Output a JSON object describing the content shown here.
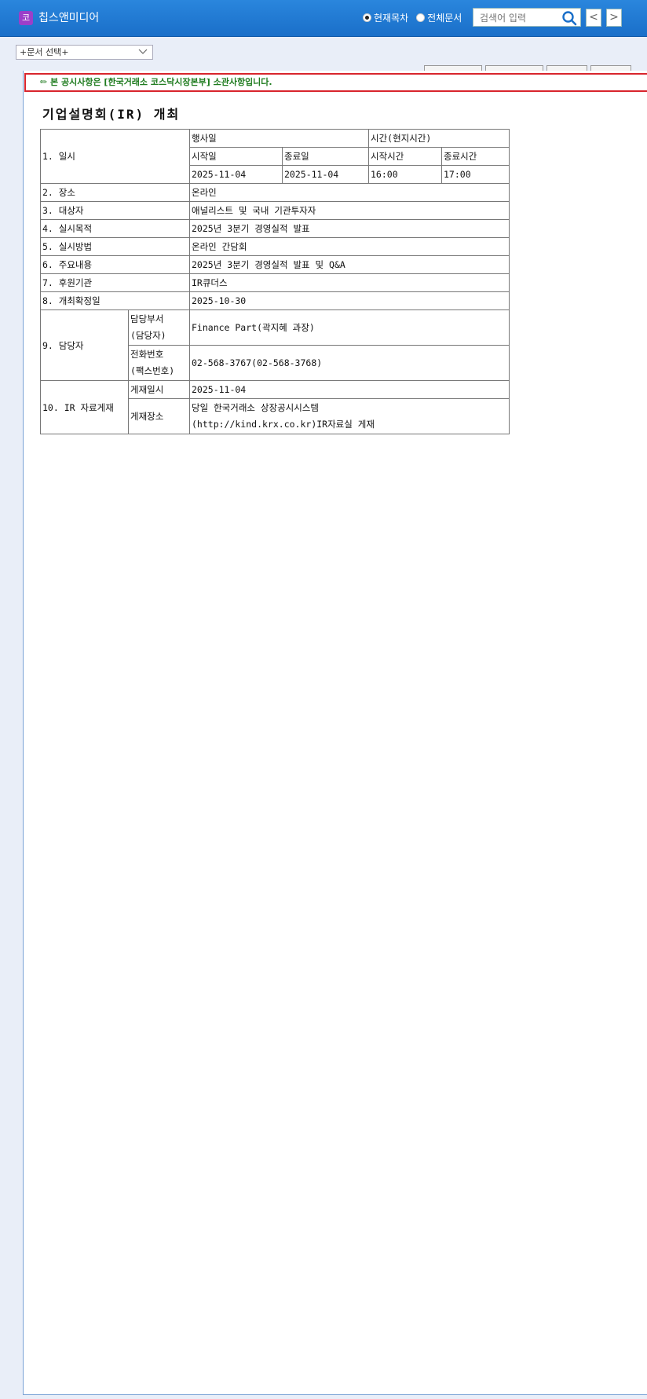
{
  "header": {
    "app_icon_text": "코",
    "app_title": "칩스앤미디어",
    "radio_current": "현재목차",
    "radio_all": "전체문서",
    "search_placeholder": "검색어 입력",
    "prev_label": "<",
    "next_label": ">"
  },
  "doc_select": {
    "value": "+문서 선택+"
  },
  "notice": {
    "text": "✏ 본 공시사항은 [한국거래소 코스닥시장본부] 소관사항입니다."
  },
  "document": {
    "title": "기업설명회(IR) 개최",
    "table": {
      "r1_label": "1. 일시",
      "event_day": "행사일",
      "time_local": "시간(현지시간)",
      "start_date_label": "시작일",
      "end_date_label": "종료일",
      "start_time_label": "시작시간",
      "end_time_label": "종료시간",
      "start_date": "2025-11-04",
      "end_date": "2025-11-04",
      "start_time": "16:00",
      "end_time": "17:00",
      "r2_label": "2. 장소",
      "r2_value": "온라인",
      "r3_label": "3. 대상자",
      "r3_value": "애널리스트 및 국내 기관투자자",
      "r4_label": "4. 실시목적",
      "r4_value": "2025년 3분기 경영실적 발표",
      "r5_label": "5. 실시방법",
      "r5_value": "온라인 간담회",
      "r6_label": "6. 주요내용",
      "r6_value": "2025년 3분기 경영실적 발표 및 Q&A",
      "r7_label": "7. 후원기관",
      "r7_value": "IR큐더스",
      "r8_label": "8. 개최확정일",
      "r8_value": "2025-10-30",
      "r9_label": "9. 담당자",
      "dept_label_1": "담당부서",
      "dept_label_2": "(담당자)",
      "dept_value": "Finance Part(곽지혜 과장)",
      "phone_label_1": "전화번호",
      "phone_label_2": "(팩스번호)",
      "phone_value": "02-568-3767(02-568-3768)",
      "r10_label": "10. IR 자료게재",
      "post_date_label": "게재일시",
      "post_date_value": "2025-11-04",
      "post_place_label": "게재장소",
      "post_place_line1": "당일 한국거래소 상장공시시스템",
      "post_place_line2": "(http://kind.krx.co.kr)IR자료실 게재"
    }
  }
}
